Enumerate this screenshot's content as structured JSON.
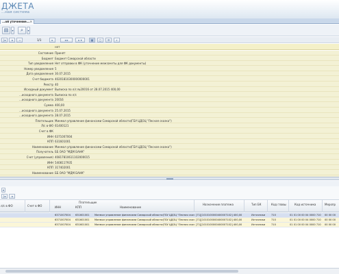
{
  "app": {
    "title": "ДЖЕТА",
    "subtitle": "...ная система"
  },
  "tab": {
    "label": "...ой уточнение...",
    "close": "×"
  },
  "toolbar": {
    "pager_text": "1/1"
  },
  "filter_value": "нет",
  "form": {
    "fields": [
      {
        "label": "Состояние",
        "value": "Принят"
      },
      {
        "label": "Бюджет",
        "value": "Бюджет Самарской области"
      },
      {
        "label": "Тип уведомления",
        "value": "Нет отправки в ФК (уточнение межзачеты для ФК документы)"
      },
      {
        "label": "Номер уведомления",
        "value": "5"
      },
      {
        "label": "Дата уведомления",
        "value": "30.07.2015"
      },
      {
        "label": "Счет бюджета",
        "value": "40201810300000000001"
      },
      {
        "label": "Реестр",
        "value": "40"
      },
      {
        "label": "Исходный документ",
        "value": "Выписка по л/с №20016 от 28.07.2015 400,00"
      },
      {
        "label": "...исходного документа",
        "value": "Выписка по л/с"
      },
      {
        "label": "...исходного документа",
        "value": "20016"
      },
      {
        "label": "Сумма",
        "value": "400,00"
      },
      {
        "label": "...исходного документа",
        "value": "25.07.2015"
      },
      {
        "label": "...исходного документа",
        "value": "28.07.2015"
      },
      {
        "label": "Плательщик",
        "value": "Минмол управление финансами Самарской области(ГБУ ЦДОЦ \"Лесная сказка\")"
      },
      {
        "label": "Л/с в ФО",
        "value": "61400121"
      },
      {
        "label": "Счет в ФК",
        "value": ""
      },
      {
        "label": "ИНН",
        "value": "6371007004"
      },
      {
        "label": "КПП",
        "value": "631601001"
      },
      {
        "label": "Наименование",
        "value": "Минмол управление финансами Самарской области(ГБУ ЦДОЦ \"Лесная сказка\")"
      },
      {
        "label": "Получатель",
        "value": "ББ ОАО \"МДМ БАНК\""
      },
      {
        "label": "Счет (управления)",
        "value": "40817810611102000015"
      },
      {
        "label": "ИНН",
        "value": "5408117935"
      },
      {
        "label": "КПП",
        "value": "317402001"
      },
      {
        "label": "Наименование",
        "value": "ББ ОАО \"МДМ БАНК\""
      }
    ]
  },
  "grid": {
    "headers": {
      "ls_fo": "л/с в ФО",
      "schet_fo": "Счет в ФО",
      "platelshik": "Плательщик",
      "inn": "ИНН",
      "kpp": "КПП",
      "naimenovanie": "Наименование",
      "naznachenie": "Назначение платежа",
      "tip_bk": "Тип БК",
      "kod_glavy": "Код главы",
      "kod_istochnika": "Код источника",
      "meropr": "Меропр"
    },
    "rows": [
      {
        "inn": "6371007004",
        "kpp": "631601001",
        "naim": "Минмол управление финансами Самарской области(ГБУ ЦДОЦ \"Лесная сказка\")",
        "nazn": "[71][1010100000400007102] 400,00",
        "tip": "Источники",
        "glava": "710",
        "ist": "01 01 00 00 04 0000 710",
        "mer": "00 00 00"
      },
      {
        "inn": "6371007004",
        "kpp": "631601001",
        "naim": "Минмол управление финансами Самарской области(ГБУ ЦДОЦ \"Лесная сказка\")",
        "nazn": "[71][1010100000400007102] 400,00",
        "tip": "Источники",
        "glava": "710",
        "ist": "01 01 00 00 04 0000 710",
        "mer": "00 00 00"
      },
      {
        "inn": "6371007004",
        "kpp": "631601001",
        "naim": "Минмол управление финансами Самарской области(ГБУ ЦДОЦ \"Лесная сказка\")",
        "nazn": "[71][1010100000400007102] 400,00",
        "tip": "Источники",
        "glava": "710",
        "ist": "01 01 00 00 04 0000 710",
        "mer": "00 00 00"
      }
    ]
  }
}
